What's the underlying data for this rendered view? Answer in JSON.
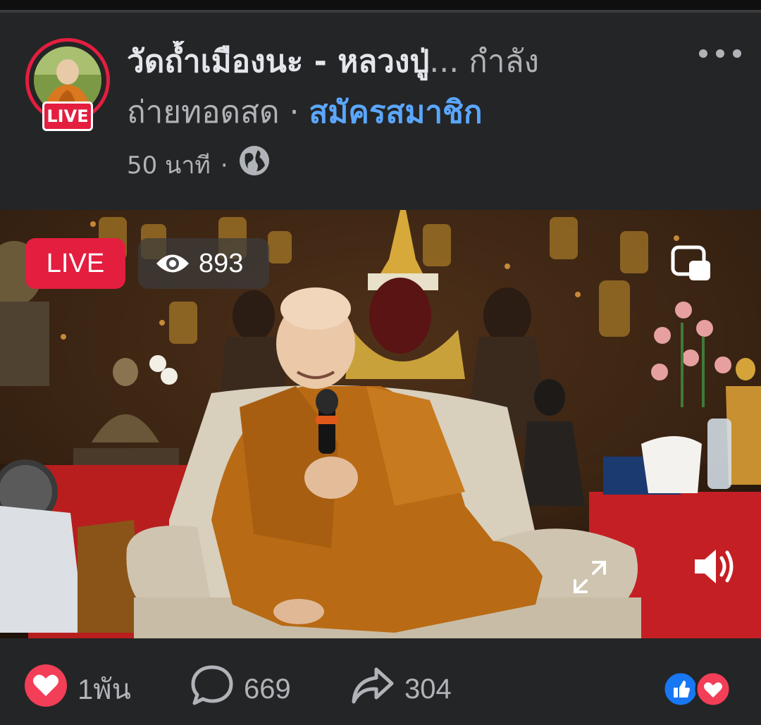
{
  "header": {
    "page_name": "วัดถ้ำเมืองนะ - หลวงปู่",
    "ellipsis": "...",
    "status_start": " กำลัง",
    "status_rest": "ถ่ายทอดสด",
    "separator": " · ",
    "subscribe_link": "สมัครสมาชิก",
    "time_ago": "50 นาที",
    "dot": "·",
    "live_badge": "LIVE"
  },
  "video": {
    "live_label": "LIVE",
    "viewer_count": "893"
  },
  "footer": {
    "likes": "1พัน",
    "comments": "669",
    "shares": "304"
  },
  "colors": {
    "live_red": "#e41e3f",
    "link_blue": "#5aa7ff",
    "background": "#242526"
  },
  "icons": [
    "more-icon",
    "globe-icon",
    "eye-icon",
    "pip-icon",
    "sound-icon",
    "expand-icon",
    "heart-icon",
    "comment-icon",
    "share-icon",
    "like-reaction-icon",
    "love-reaction-icon"
  ]
}
